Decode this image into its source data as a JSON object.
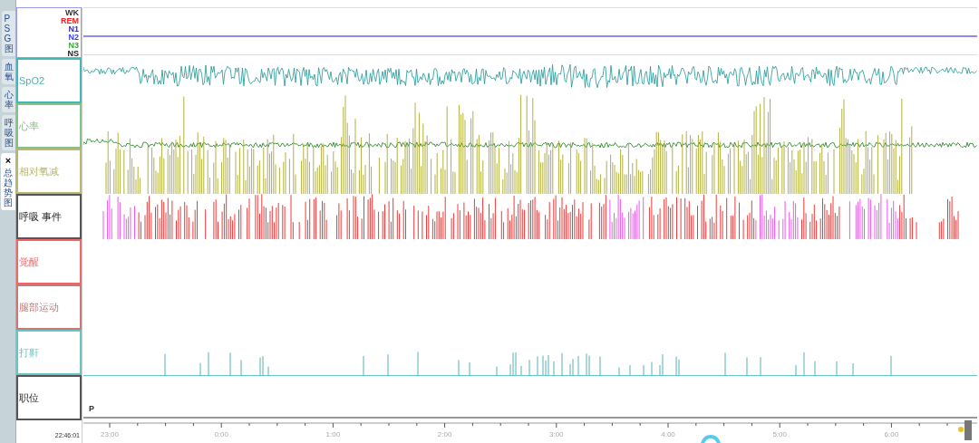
{
  "side_tabs": [
    {
      "label": "PSG图",
      "selected": false,
      "closable": false
    },
    {
      "label": "血氧",
      "selected": false,
      "closable": false
    },
    {
      "label": "心率",
      "selected": false,
      "closable": false
    },
    {
      "label": "呼吸图",
      "selected": false,
      "closable": false
    },
    {
      "label": "总趋势图",
      "selected": true,
      "closable": true,
      "close_glyph": "×"
    }
  ],
  "stages": [
    {
      "label": "WK",
      "color": "#333333"
    },
    {
      "label": "REM",
      "color": "#ee2222"
    },
    {
      "label": "N1",
      "color": "#333399"
    },
    {
      "label": "N2",
      "color": "#3344ee"
    },
    {
      "label": "N3",
      "color": "#33aa33"
    },
    {
      "label": "NS",
      "color": "#222222"
    }
  ],
  "tracks": [
    {
      "label": "SpO2",
      "kind": "spo2",
      "color": "#44b8b8"
    },
    {
      "label": "心率",
      "kind": "heart",
      "color": "#88c088"
    },
    {
      "label": "相对氧减",
      "kind": "odi",
      "color": "#b8b870"
    },
    {
      "label": "呼吸 事件",
      "kind": "resp",
      "color": "#555555"
    },
    {
      "label": "觉醒",
      "kind": "arousal",
      "color": "#ee6666"
    },
    {
      "label": "腿部运动",
      "kind": "leg",
      "color": "#cc7777"
    },
    {
      "label": "打鼾",
      "kind": "snore",
      "color": "#66c4c4"
    },
    {
      "label": "职位",
      "kind": "position",
      "color": "#555555"
    }
  ],
  "position_marker": "P",
  "start_time": "22:46:01",
  "time_axis": [
    "23:00",
    "0:00",
    "1:00",
    "2:00",
    "3:00",
    "4:00",
    "5:00",
    "6:00"
  ]
}
